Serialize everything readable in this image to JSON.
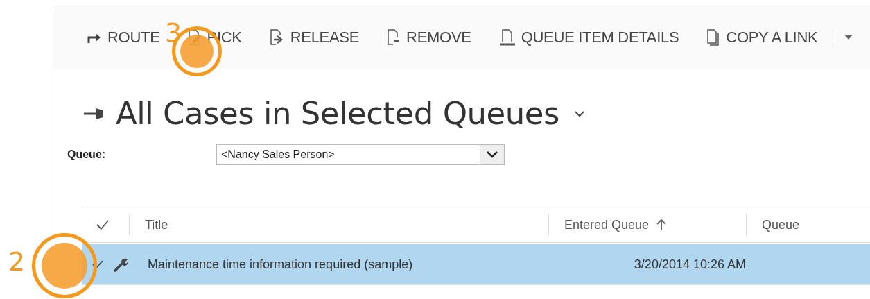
{
  "toolbar": {
    "items": [
      {
        "label": "ROUTE"
      },
      {
        "label": "PICK"
      },
      {
        "label": "RELEASE"
      },
      {
        "label": "REMOVE"
      },
      {
        "label": "QUEUE ITEM DETAILS"
      },
      {
        "label": "COPY A LINK"
      }
    ],
    "more_menu": true
  },
  "view": {
    "title": "All Cases in Selected Queues",
    "pinned": true
  },
  "queue_filter": {
    "label": "Queue:",
    "value": "<Nancy Sales Person>"
  },
  "grid": {
    "columns": [
      {
        "label": "Title",
        "sorted": false
      },
      {
        "label": "Entered Queue",
        "sorted": true
      },
      {
        "label": "Queue",
        "sorted": false
      }
    ],
    "rows": [
      {
        "selected": true,
        "title": "Maintenance time information required (sample)",
        "entered_queue": "3/20/2014 10:26 AM"
      }
    ]
  },
  "callouts": [
    {
      "number": "3"
    },
    {
      "number": "2"
    }
  ]
}
